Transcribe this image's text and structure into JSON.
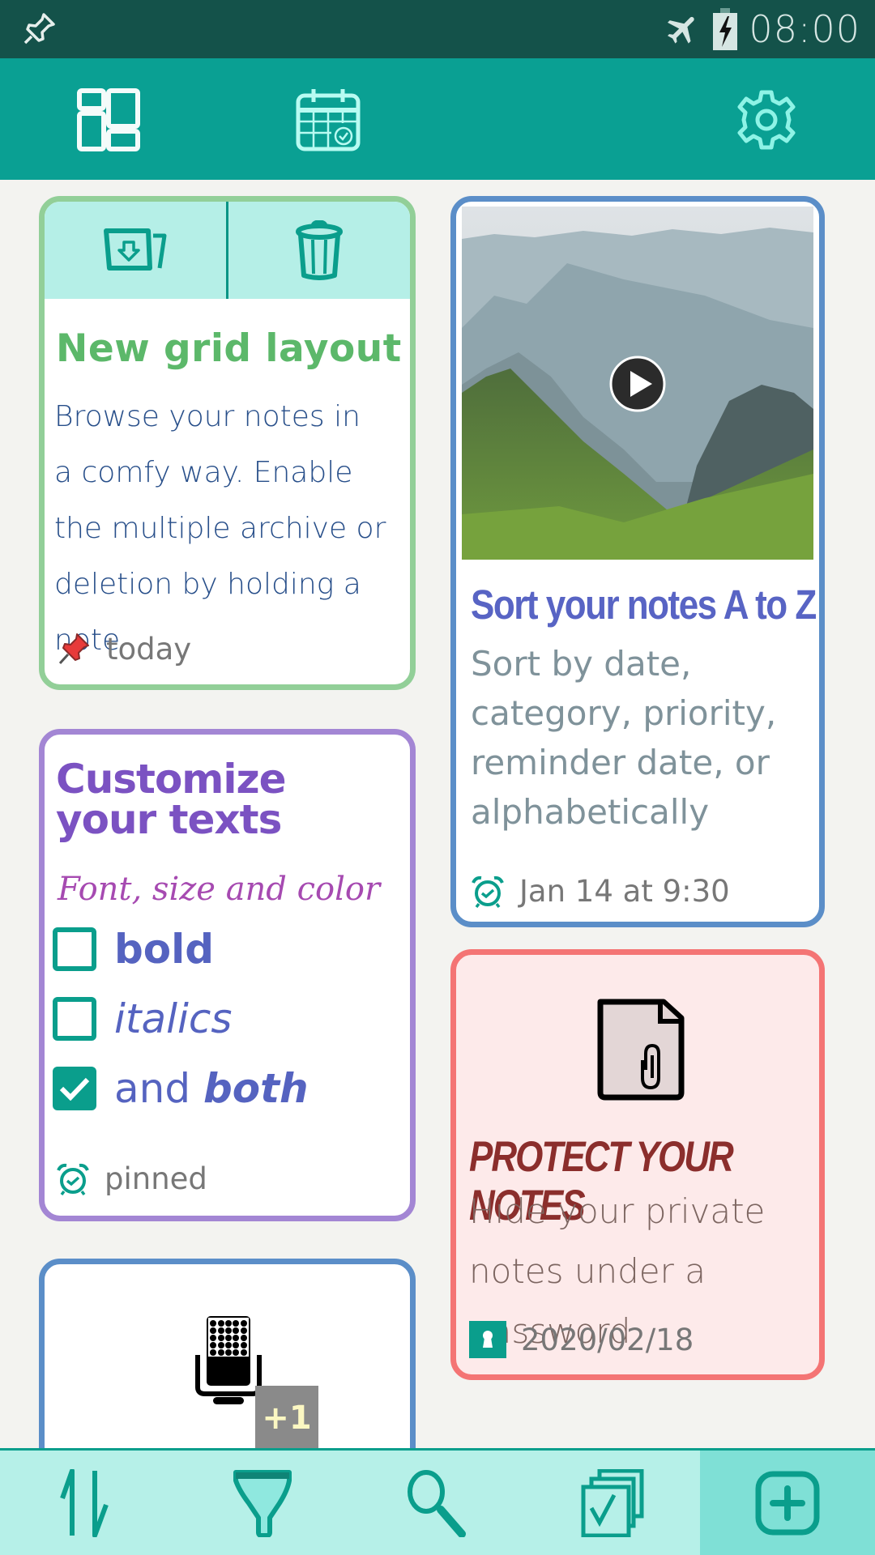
{
  "status_bar": {
    "left_icon": "pushpin-notification-icon",
    "icons": [
      "airplane-mode-icon",
      "battery-charging-icon"
    ],
    "time": "08:00"
  },
  "app_bar": {
    "buttons": [
      {
        "name": "grid-layout",
        "icon": "grid-layout-icon"
      },
      {
        "name": "calendar",
        "icon": "calendar-alarm-icon"
      },
      {
        "name": "settings",
        "icon": "gear-icon"
      }
    ]
  },
  "colors": {
    "status_bar": "#14524a",
    "app_bar": "#0aa093",
    "accent": "#0a9e8c",
    "bottom_bar": "#b6f0e8",
    "bottom_bar_active": "#7fe0d6"
  },
  "notes": [
    {
      "id": "new-grid-layout",
      "border_color": "#92cf98",
      "actions": [
        {
          "icon": "archive-folder-icon",
          "label": "Archive"
        },
        {
          "icon": "trash-icon",
          "label": "Delete"
        }
      ],
      "title": "New grid layout",
      "body_lines": [
        "Browse your notes in",
        "a comfy way. Enable",
        "the multiple archive or",
        "deletion by holding a note"
      ],
      "meta_icon": "red-pushpin-icon",
      "meta": "today"
    },
    {
      "id": "sort-notes",
      "border_color": "#5b8ec8",
      "image": "mountain-landscape-video-thumbnail",
      "overlay_icon": "play-icon",
      "title": "Sort your notes A to Z",
      "body": "Sort by date, category, priority, reminder date, or alphabetically",
      "meta_icon": "alarm-clock-icon",
      "meta": "Jan 14 at 9:30"
    },
    {
      "id": "customize-texts",
      "border_color": "#a386d4",
      "title_lines": [
        "Customize",
        "your texts"
      ],
      "subtitle": "Font, size and color",
      "checklist": [
        {
          "label": "bold",
          "checked": false
        },
        {
          "label": "italics",
          "checked": false
        },
        {
          "label_plain": "and ",
          "label_emph": "both",
          "checked": true
        }
      ],
      "meta_icon": "alarm-clock-icon",
      "meta": "pinned"
    },
    {
      "id": "audio-note",
      "border_color": "#5b8ec8",
      "icon": "microphone-icon",
      "badge": "+1"
    },
    {
      "id": "protect-notes",
      "border_color": "#f47474",
      "icon": "file-attachment-icon",
      "title": "PROTECT YOUR NOTES",
      "body_lines": [
        "Hide your private",
        "notes under a",
        "password"
      ],
      "meta_icon": "lock-icon",
      "meta": "2020/02/18"
    }
  ],
  "bottom_bar": {
    "buttons": [
      {
        "name": "sort",
        "icon": "sort-arrows-icon"
      },
      {
        "name": "filter",
        "icon": "filter-funnel-icon"
      },
      {
        "name": "search",
        "icon": "search-icon"
      },
      {
        "name": "multi-select",
        "icon": "multi-select-check-icon"
      },
      {
        "name": "add-note",
        "icon": "add-square-icon",
        "active": true
      }
    ]
  }
}
